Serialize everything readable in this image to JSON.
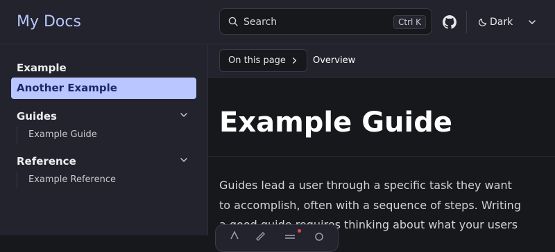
{
  "header": {
    "site_title": "My Docs",
    "search": {
      "label": "Search",
      "shortcut": "Ctrl K"
    },
    "theme": {
      "label": "Dark"
    }
  },
  "sidebar": {
    "items": [
      {
        "label": "Example"
      },
      {
        "label": "Another Example",
        "active": true
      }
    ],
    "groups": [
      {
        "label": "Guides",
        "children": [
          "Example Guide"
        ]
      },
      {
        "label": "Reference",
        "children": [
          "Example Reference"
        ]
      }
    ]
  },
  "page": {
    "on_this_page": "On this page",
    "current_section": "Overview",
    "title": "Example Guide",
    "body": "Guides lead a user through a specific task they want to accomplish, often with a sequence of steps. Writing a good guide requires thinking about what your users are trying to do."
  },
  "colors": {
    "accent": "#b9c6ff",
    "background": "#17181c",
    "panel": "#22232c"
  },
  "icons": [
    "search-icon",
    "github-icon",
    "moon-icon",
    "chevron-down-icon",
    "chevron-right-icon"
  ]
}
